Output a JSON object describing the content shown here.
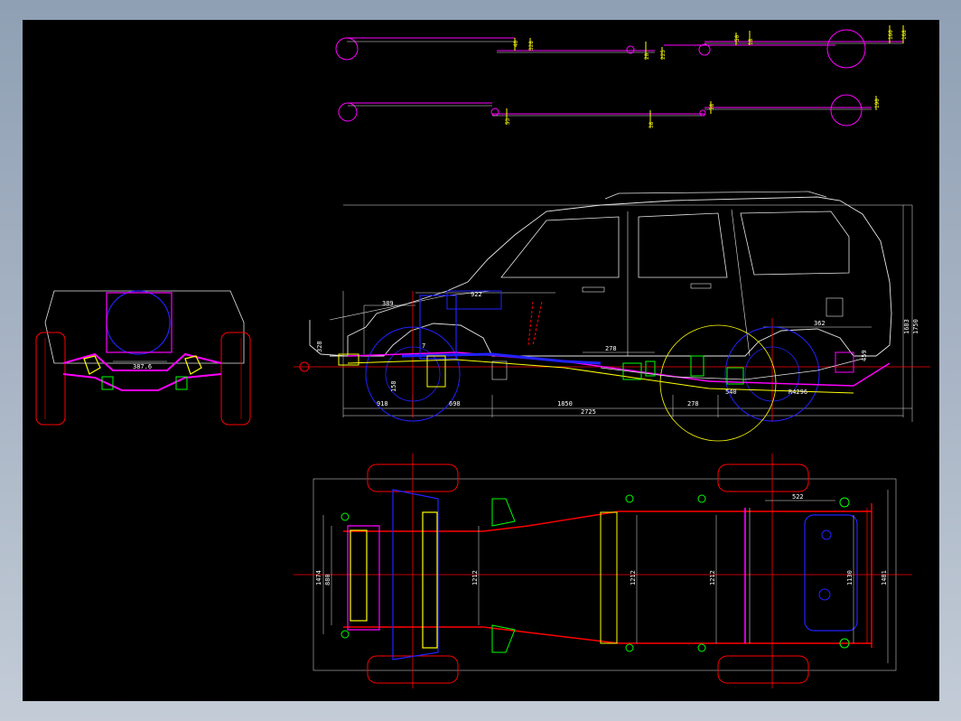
{
  "drawing": {
    "background": "#000000",
    "colors": {
      "outline": "#e6e6e6",
      "magenta": "#ff00ff",
      "red": "#ff0000",
      "blue": "#2222ff",
      "yellow": "#ffff00",
      "green": "#00ff00",
      "cyan": "#00ffff"
    }
  },
  "side_view": {
    "dims": {
      "front_overhang": "918",
      "front_span": "698",
      "mid_span": "1850",
      "rear_span": "278",
      "wheelbase": "2725",
      "top_left": "389",
      "top_mid": "922",
      "top_right": "362",
      "mid_right": "278",
      "height_1": "1683",
      "height_2": "1750",
      "left_vert": "328",
      "rear_vert": "459",
      "center": "7",
      "vert_small": "158",
      "rear_low": "540",
      "rear_diag": "R4296"
    }
  },
  "front_view": {
    "dims": {
      "track": "387.6"
    }
  },
  "plan_view": {
    "dims": {
      "width_outer": "1474",
      "width_inner": "880",
      "frame_1": "1212",
      "frame_2": "1212",
      "frame_3": "1212",
      "rear_top": "522",
      "rear_w1": "1130",
      "rear_w2": "1481"
    }
  },
  "spring_details": {
    "row1": {
      "a": "40",
      "b": "328",
      "c": "20",
      "d": "225",
      "e": "50",
      "f": "18",
      "g": "160",
      "h": "168"
    },
    "row2": {
      "a": "53",
      "b": "38",
      "c": "58",
      "d": "190"
    }
  }
}
